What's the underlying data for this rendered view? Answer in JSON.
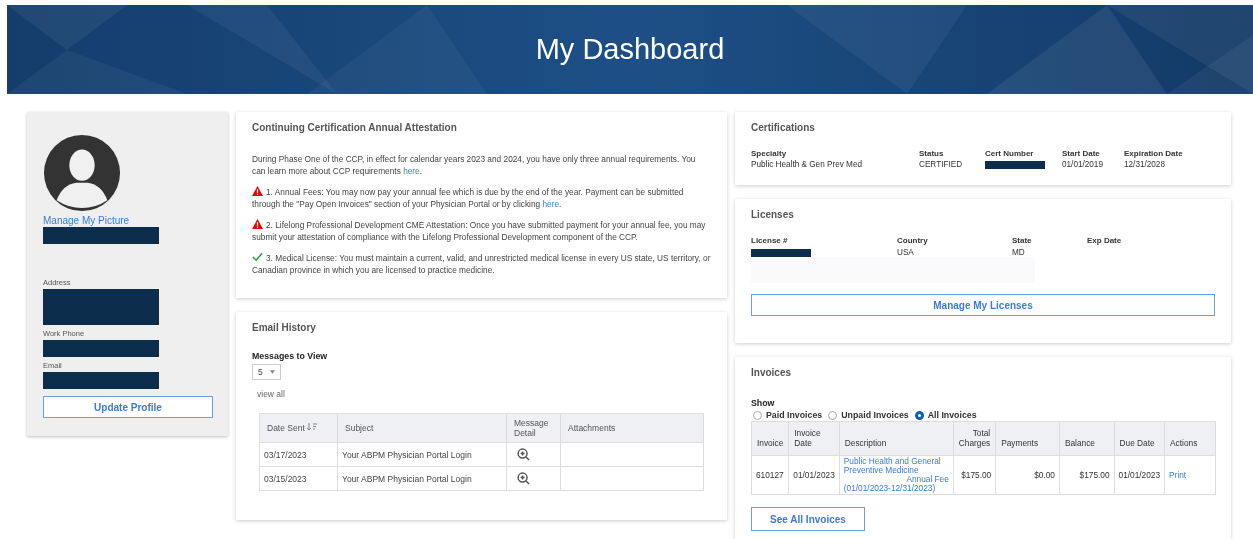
{
  "header": {
    "title": "My Dashboard"
  },
  "profile": {
    "picture_link": "Manage My Picture",
    "fields": [
      {
        "label": "Address"
      },
      {
        "label": "Work Phone"
      },
      {
        "label": "Email"
      }
    ],
    "button": "Update Profile"
  },
  "attestation": {
    "title": "Continuing Certification Annual Attestation",
    "items": [
      {
        "kind": "plain",
        "text": "During Phase One of the CCP, in effect for calendar years 2023 and 2024, you have only three annual requirements. You can learn more about CCP requirements ",
        "link": "here",
        "after": "."
      },
      {
        "kind": "warning",
        "text": "1. Annual Fees: You may now pay your annual fee which is due by the end of the year. Payment can be submitted through the \"Pay Open Invoices\" section of your Physician Portal or by clicking ",
        "link": "here",
        "after": "."
      },
      {
        "kind": "warning",
        "text": "2. Lifelong Professional Development CME Attestation: Once you have submitted payment for your annual fee, you may submit your attestation of compliance with the Lifelong Professional Development component of the CCP."
      },
      {
        "kind": "done",
        "text": "3. Medical License: You must maintain a current, valid, and unrestricted medical license in every US state, US territory, or Canadian province in which you are licensed to practice medicine."
      }
    ]
  },
  "email_history": {
    "title": "Email History",
    "messages_label": "Messages to View",
    "per_page": "5",
    "view_all": "view all",
    "columns": [
      {
        "label": "Date Sent",
        "sortable": true
      },
      {
        "label": "Subject",
        "sortable": false
      },
      {
        "label": "Message Detail",
        "sortable": false
      },
      {
        "label": "Attachments",
        "sortable": false
      }
    ],
    "rows": [
      {
        "date": "03/17/2023",
        "subject": "Your ABPM Physician Portal Login"
      },
      {
        "date": "03/15/2023",
        "subject": "Your ABPM Physician Portal Login"
      }
    ]
  },
  "certifications": {
    "title": "Certifications",
    "columns": [
      "Specialty",
      "Status",
      "Cert Number",
      "Start Date",
      "Expiration Date"
    ],
    "rows": [
      [
        {
          "text": "Public Health & Gen Prev Med"
        },
        {
          "text": "CERTIFIED"
        },
        {
          "redacted": true
        },
        {
          "text": "01/01/2019"
        },
        {
          "text": "12/31/2028"
        }
      ]
    ]
  },
  "licenses": {
    "title": "Licenses",
    "columns": [
      "License #",
      "Country",
      "State",
      "Exp Date"
    ],
    "rows": [
      [
        {
          "redacted": true
        },
        {
          "text": "USA"
        },
        {
          "text": "MD"
        }
      ]
    ],
    "button": "Manage My Licenses"
  },
  "invoices": {
    "title": "Invoices",
    "show_label": "Show",
    "filters": [
      {
        "label": "Paid Invoices",
        "selected": false
      },
      {
        "label": "Unpaid Invoices",
        "selected": false
      },
      {
        "label": "All Invoices",
        "selected": true
      }
    ],
    "columns": [
      "Invoice",
      "Invoice Date",
      "Description",
      "Total Charges",
      "Payments",
      "Balance",
      "Due Date",
      "Actions"
    ],
    "rows": [
      {
        "invoice": "610127",
        "date": "01/01/2023",
        "description": [
          "Public Health and General Preventive Medicine",
          "Annual Fee",
          "(01/01/2023-12/31/2023)"
        ],
        "total": "$175.00",
        "payments": "$0.00",
        "balance": "$175.00",
        "due": "01/01/2023",
        "action": "Print"
      }
    ],
    "button": "See All Invoices"
  }
}
